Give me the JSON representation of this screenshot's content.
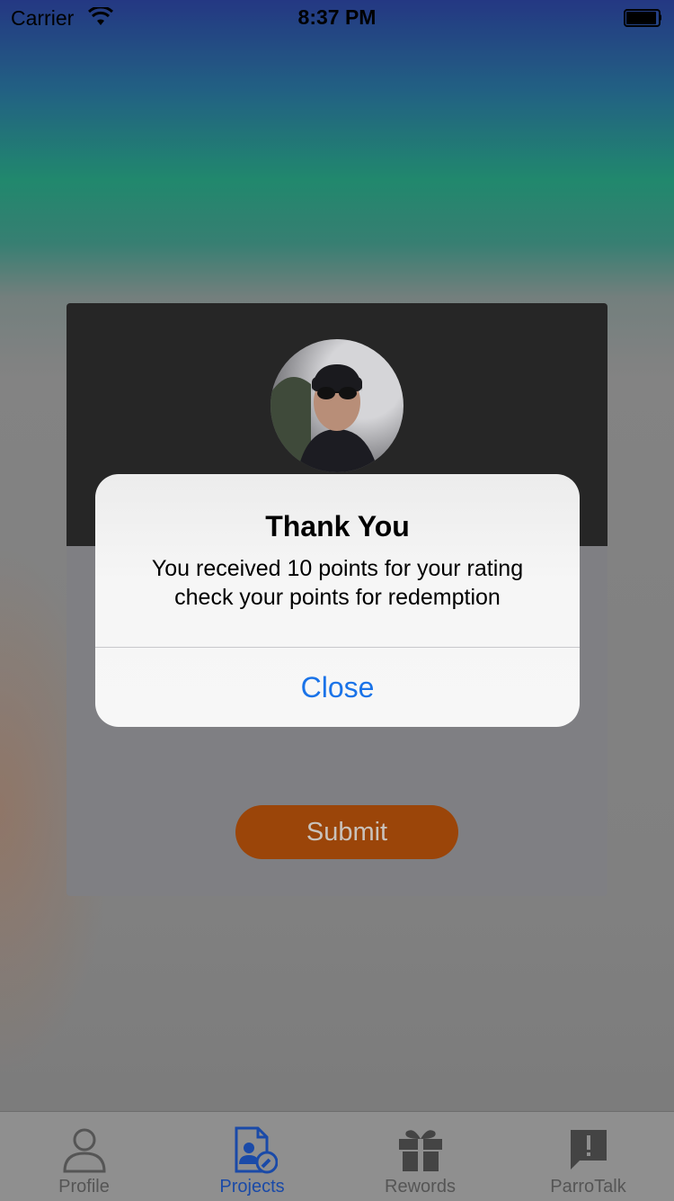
{
  "status_bar": {
    "carrier": "Carrier",
    "time": "8:37 PM"
  },
  "card": {
    "submit_label": "Submit"
  },
  "alert": {
    "title": "Thank You",
    "message_line1": "You received 10 points for your rating",
    "message_line2": "check your points for redemption",
    "close_label": "Close"
  },
  "tabs": [
    {
      "label": "Profile",
      "icon": "person-icon",
      "active": false
    },
    {
      "label": "Projects",
      "icon": "projects-icon",
      "active": true
    },
    {
      "label": "Rewords",
      "icon": "gift-icon",
      "active": false
    },
    {
      "label": "ParroTalk",
      "icon": "chat-alert-icon",
      "active": false
    }
  ],
  "colors": {
    "accent_blue": "#1a73e8",
    "active_tab": "#1a4aa8",
    "submit_orange": "#9b4509"
  }
}
